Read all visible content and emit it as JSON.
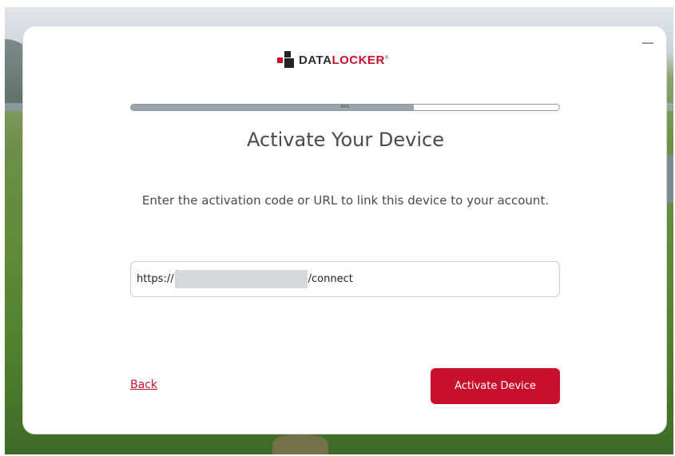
{
  "brand": {
    "name_part1": "DATA",
    "name_part2": "LOCKER",
    "registered_mark": "®",
    "accent_color": "#c8102e"
  },
  "progress": {
    "value_percent": 66,
    "label": "66%"
  },
  "main": {
    "title": "Activate Your Device",
    "instruction": "Enter the activation code or URL to link this device to your account."
  },
  "url_field": {
    "prefix": "https://",
    "redacted": true,
    "suffix": "/connect"
  },
  "actions": {
    "back_label": "Back",
    "activate_label": "Activate Device"
  },
  "window": {
    "minimize_icon": "minimize-icon"
  }
}
